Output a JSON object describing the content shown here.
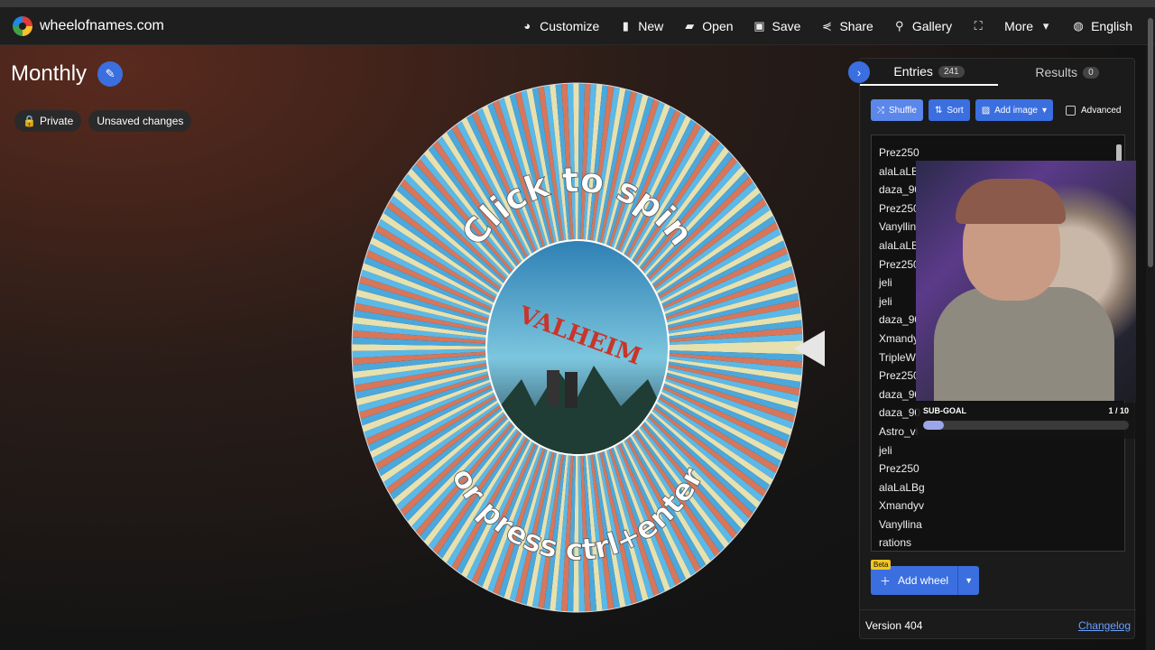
{
  "site": {
    "name": "wheelofnames.com"
  },
  "nav": {
    "items": [
      {
        "label": "Customize",
        "icon": "palette-icon",
        "glyph": "◕"
      },
      {
        "label": "New",
        "icon": "file-icon",
        "glyph": "▮"
      },
      {
        "label": "Open",
        "icon": "folder-icon",
        "glyph": "▰"
      },
      {
        "label": "Save",
        "icon": "floppy-icon",
        "glyph": "▣"
      },
      {
        "label": "Share",
        "icon": "share-icon",
        "glyph": "⋞"
      },
      {
        "label": "Gallery",
        "icon": "search-icon",
        "glyph": "⚲"
      },
      {
        "label": "",
        "icon": "fullscreen-icon",
        "glyph": "⛶"
      },
      {
        "label": "More",
        "icon": "chevron-down-icon",
        "glyph": "▾"
      },
      {
        "label": "English",
        "icon": "globe-icon",
        "glyph": "◍"
      }
    ]
  },
  "wheel": {
    "title": "Monthly",
    "privacy_label": "Private",
    "status_label": "Unsaved changes",
    "top_text": "Click to spin",
    "bottom_text": "or press ctrl+enter",
    "center_image_text": "VALHEIM",
    "segment_colors": [
      "#e7e1b0",
      "#4aa8dc",
      "#d7765a",
      "#5ab9e8"
    ]
  },
  "panel": {
    "tabs": [
      {
        "label": "Entries",
        "count": "241"
      },
      {
        "label": "Results",
        "count": "0"
      }
    ],
    "toolbar": {
      "shuffle": "Shuffle",
      "sort": "Sort",
      "add_image": "Add image",
      "advanced": "Advanced"
    },
    "entries": [
      "Prez250",
      "alaLaLBg",
      "daza_90",
      "Prez250",
      "Vanyllina",
      "alaLaLBg",
      "Prez250",
      "jeli",
      "jeli",
      "daza_90",
      "Xmandyv",
      "TripleWh",
      "Prez250",
      "daza_90",
      "daza_90",
      "Astro_vi",
      "jeli",
      "Prez250",
      "alaLaLBg",
      "Xmandyv",
      "Vanyllina",
      "rations"
    ],
    "subgoal": {
      "label": "SUB-GOAL",
      "progress_text": "1 / 10",
      "fraction": 0.1
    },
    "add_wheel": {
      "label": "Add wheel",
      "beta": "Beta"
    },
    "footer": {
      "version": "Version 404",
      "changelog": "Changelog"
    }
  }
}
